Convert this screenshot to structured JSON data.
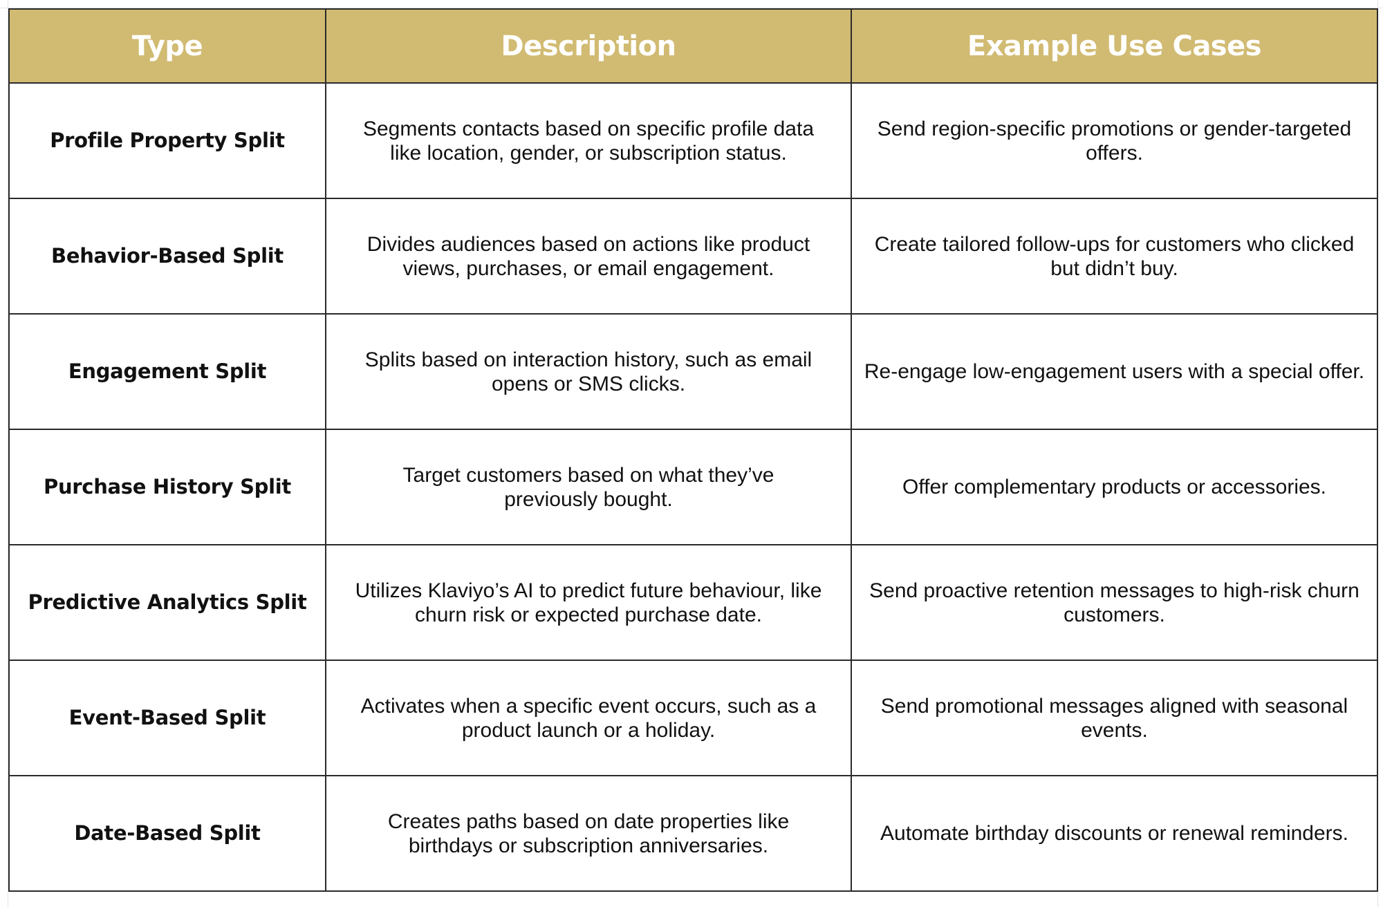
{
  "table": {
    "header_color": "#D1BB72",
    "columns": [
      "Type",
      "Description",
      "Example Use Cases"
    ],
    "rows": [
      {
        "type": "Profile Property Split",
        "description": "Segments contacts based on specific profile data like location, gender, or subscription status.",
        "use_case": "Send region-specific promotions or gender-targeted offers."
      },
      {
        "type": "Behavior-Based Split",
        "description": "Divides audiences based on actions like product views, purchases, or email engagement.",
        "use_case": "Create tailored follow-ups for customers who clicked but didn’t buy."
      },
      {
        "type": "Engagement Split",
        "description": "Splits based on interaction history, such as email opens or SMS clicks.",
        "use_case": "Re-engage low-engagement users with a special offer."
      },
      {
        "type": "Purchase History Split",
        "description": "Target customers based on what they’ve previously bought.",
        "use_case": "Offer complementary products or accessories."
      },
      {
        "type": "Predictive Analytics Split",
        "description": "Utilizes Klaviyo’s AI to predict future behaviour, like churn risk or expected purchase date.",
        "use_case": "Send proactive retention messages to high-risk churn customers."
      },
      {
        "type": "Event-Based Split",
        "description": "Activates when a specific event occurs, such as a product launch or a holiday.",
        "use_case": "Send promotional messages aligned with seasonal events."
      },
      {
        "type": "Date-Based Split",
        "description": "Creates paths based on date properties like birthdays or subscription anniversaries.",
        "use_case": "Automate birthday discounts or renewal reminders."
      }
    ]
  }
}
